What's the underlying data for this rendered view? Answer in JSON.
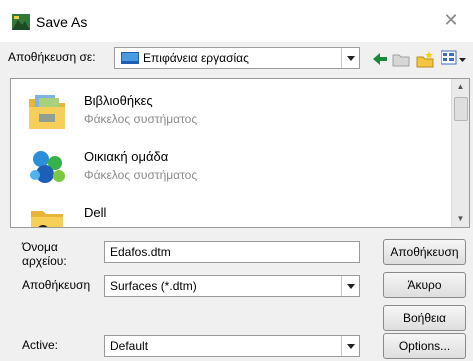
{
  "window": {
    "title": "Save As",
    "close_glyph": "✕"
  },
  "toolbar": {
    "save_in_label": "Αποθήκευση σε:",
    "location": "Επιφάνεια εργασίας",
    "icons": [
      "back-arrow-icon",
      "up-folder-icon",
      "new-folder-icon",
      "views-menu-icon"
    ]
  },
  "files": [
    {
      "name": "Βιβλιοθήκες",
      "type": "Φάκελος συστήματος",
      "icon": "libraries-folder-icon"
    },
    {
      "name": "Οικιακή ομάδα",
      "type": "Φάκελος συστήματος",
      "icon": "homegroup-icon"
    },
    {
      "name": "Dell",
      "type": "",
      "icon": "user-folder-icon"
    }
  ],
  "form": {
    "filename_label": "Όνομα αρχείου:",
    "filename_value": "Edafos.dtm",
    "savetype_label": "Αποθήκευση",
    "savetype_value": "Surfaces (*.dtm)",
    "active_label": "Active:",
    "active_value": "Default"
  },
  "buttons": {
    "save": "Αποθήκευση",
    "cancel": "Άκυρο",
    "help": "Βοήθεια",
    "options": "Options..."
  },
  "colors": {
    "accent": "#1e5fb3",
    "folder": "#f5c542",
    "muted_text": "#8c8c8c",
    "back_arrow": "#1a8a3a"
  }
}
